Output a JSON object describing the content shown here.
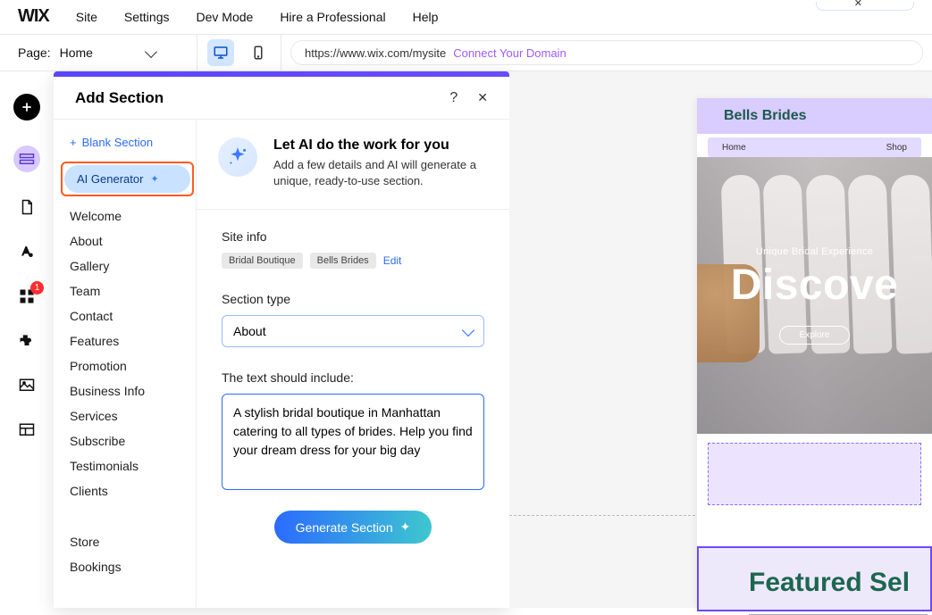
{
  "logo": "WIX",
  "menu": {
    "site": "Site",
    "settings": "Settings",
    "devmode": "Dev Mode",
    "hire": "Hire a Professional",
    "help": "Help"
  },
  "topBadgeGlyph": "✕",
  "page": {
    "label": "Page:",
    "value": "Home"
  },
  "url": {
    "path": "https://www.wix.com/mysite",
    "connect": "Connect Your Domain"
  },
  "rail": {
    "badgeCount": "1"
  },
  "panel": {
    "title": "Add Section",
    "help": "?",
    "close": "✕",
    "blank": "Blank Section",
    "aiGen": "AI Generator",
    "cats": [
      "Welcome",
      "About",
      "Gallery",
      "Team",
      "Contact",
      "Features",
      "Promotion",
      "Business Info",
      "Services",
      "Subscribe",
      "Testimonials",
      "Clients"
    ],
    "cats2": [
      "Store",
      "Bookings"
    ]
  },
  "hero": {
    "title": "Let AI do the work for you",
    "desc": "Add a few details and AI will generate a unique, ready-to-use section."
  },
  "form": {
    "siteInfoLabel": "Site info",
    "chip1": "Bridal Boutique",
    "chip2": "Bells Brides",
    "edit": "Edit",
    "sectionTypeLabel": "Section type",
    "sectionTypeValue": "About",
    "textLabel": "The text should include:",
    "textValue": "A stylish bridal boutique in Manhattan catering to all types of brides. Help you find your dream dress for your big day",
    "generate": "Generate Section"
  },
  "preview": {
    "brand": "Bells Brides",
    "navHome": "Home",
    "navShop": "Shop",
    "sub": "Unique Bridal Experience",
    "big": "Discove",
    "cta": "Explore",
    "featured": "Featured Sel"
  }
}
